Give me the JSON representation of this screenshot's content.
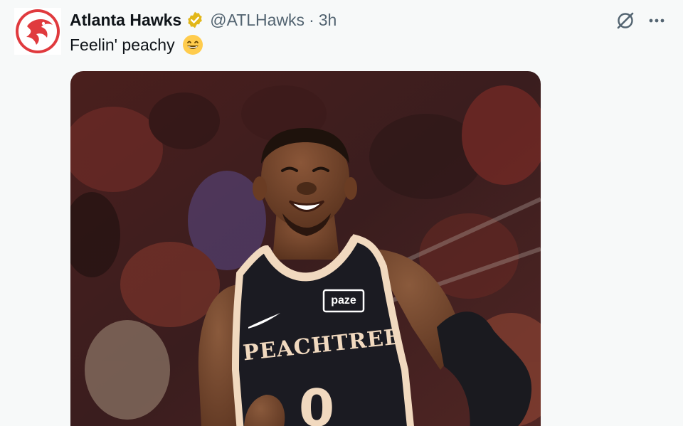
{
  "tweet": {
    "author_name": "Atlanta Hawks",
    "handle": "@ATLHawks",
    "separator": "·",
    "timestamp": "3h",
    "text": "Feelin' peachy",
    "emoji": "grinning-face-with-smiling-eyes",
    "verified_color": "#e2b719"
  },
  "media": {
    "jersey_text": "PEACHTREE",
    "sponsor_patch": "paze",
    "jersey_number": "0",
    "colors": {
      "jersey": "#1b1b22",
      "trim": "#f1d9bf",
      "background": "#3a1d1e"
    }
  },
  "icons": {
    "avatar": "hawks-logo",
    "verified": "verified-badge-icon",
    "grok": "grok-icon",
    "more": "more-icon"
  },
  "colors": {
    "brand_red": "#e03a3e",
    "text_primary": "#0f1419",
    "text_secondary": "#536471"
  }
}
